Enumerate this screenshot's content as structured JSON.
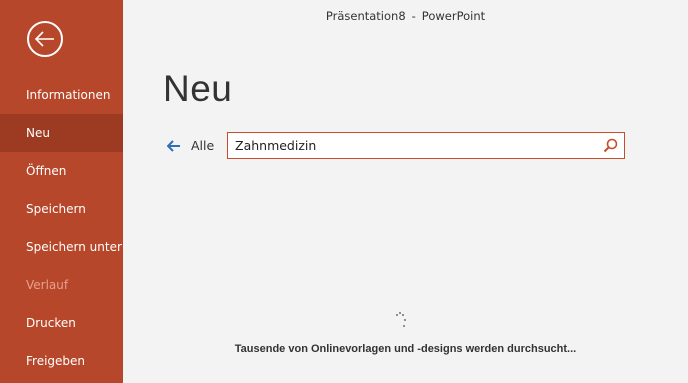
{
  "window": {
    "doc_name": "Präsentation8",
    "separator": "-",
    "app_name": "PowerPoint"
  },
  "sidebar": {
    "back_icon": "back-arrow-circle-icon",
    "items": [
      {
        "label": "Informationen",
        "state": "normal"
      },
      {
        "label": "Neu",
        "state": "active"
      },
      {
        "label": "Öffnen",
        "state": "normal"
      },
      {
        "label": "Speichern",
        "state": "normal"
      },
      {
        "label": "Speichern unter",
        "state": "normal"
      },
      {
        "label": "Verlauf",
        "state": "disabled"
      },
      {
        "label": "Drucken",
        "state": "normal"
      },
      {
        "label": "Freigeben",
        "state": "normal"
      }
    ]
  },
  "main": {
    "title": "Neu",
    "back_all_label": "Alle",
    "search": {
      "value": "Zahnmedizin",
      "icon": "search-icon"
    },
    "status_text": "Tausende von Onlinevorlagen und -designs werden durchsucht..."
  },
  "colors": {
    "sidebar_bg": "#b7472a",
    "sidebar_active": "#9c3b22",
    "accent_blue": "#2e6fb5",
    "search_border": "#c94b2b"
  }
}
